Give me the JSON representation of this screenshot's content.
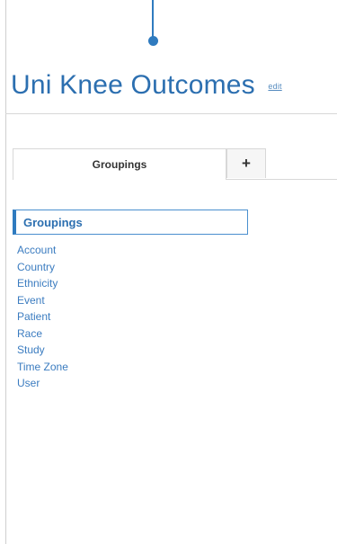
{
  "header": {
    "title": "Uni Knee Outcomes",
    "edit_label": "edit"
  },
  "tabs": [
    {
      "label": "Groupings",
      "active": true
    },
    {
      "label": "+",
      "active": false
    }
  ],
  "groupings": {
    "header": "Groupings",
    "items": [
      {
        "label": "Account"
      },
      {
        "label": "Country"
      },
      {
        "label": "Ethnicity"
      },
      {
        "label": "Event"
      },
      {
        "label": "Patient"
      },
      {
        "label": "Race"
      },
      {
        "label": "Study"
      },
      {
        "label": "Time Zone"
      },
      {
        "label": "User"
      }
    ]
  },
  "colors": {
    "accent": "#2f7bbf",
    "link": "#3b7cc0"
  }
}
